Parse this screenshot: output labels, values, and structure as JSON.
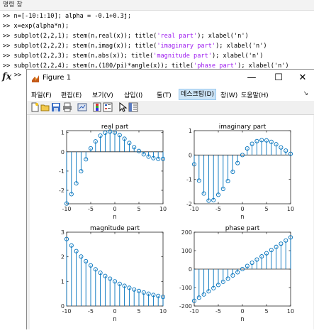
{
  "command_window": {
    "title": "명령 창",
    "lines": [
      {
        "prompt": ">>",
        "pre": "n=[-10:1:10]; alpha = -0.1+0.3j;",
        "str": "",
        "post": ""
      },
      {
        "prompt": ">>",
        "pre": "x=exp(alpha*n);",
        "str": "",
        "post": ""
      },
      {
        "prompt": ">>",
        "pre": "subplot(2,2,1); stem(n,real(x)); title(",
        "str": "'real part'",
        "post": "); xlabel('n')"
      },
      {
        "prompt": ">>",
        "pre": "subplot(2,2,2); stem(n,imag(x)); title(",
        "str": "'imaginary part'",
        "post": "); xlabel('n')"
      },
      {
        "prompt": ">>",
        "pre": "subplot(2,2,3); stem(n,abs(x)); title(",
        "str": "'magnitude part'",
        "post": "); xlabel('n')"
      },
      {
        "prompt": ">>",
        "pre": "subplot(2,2,4); stem(n,(180/pi)*angle(x)); title(",
        "str": "'phase part'",
        "post": "); xlabel('n')"
      }
    ],
    "fx_symbol": "fx",
    "current_prompt": ">>"
  },
  "figure": {
    "title": "Figure 1",
    "window_buttons": {
      "minimize": "—",
      "maximize": "☐",
      "close": "✕"
    },
    "menu": [
      "파일(F)",
      "편집(E)",
      "보기(V)",
      "삽입(I)",
      "툴(T)",
      "데스크탑(D)",
      "창(W)",
      "도움말(H)"
    ],
    "active_menu": "데스크탑(D)",
    "menu_arrow": "↘",
    "toolbar_icons": [
      "new-figure-icon",
      "open-file-icon",
      "save-icon",
      "print-icon",
      "link-plot-icon",
      "insert-colorbar-icon",
      "insert-legend-icon",
      "pointer-icon",
      "property-inspector-icon"
    ]
  },
  "chart_data": [
    {
      "type": "scatter",
      "style": "stem",
      "title": "real part",
      "xlabel": "n",
      "xlim": [
        -10,
        10
      ],
      "ylim": [
        -2.7,
        1.1
      ],
      "xticks": [
        "-10",
        "-5",
        "0",
        "5",
        "10"
      ],
      "yticks": [
        "-2",
        "-1",
        "0",
        "1"
      ],
      "ytick_values": [
        -2,
        -1,
        0,
        1
      ],
      "x": [
        -10,
        -9,
        -8,
        -7,
        -6,
        -5,
        -4,
        -3,
        -2,
        -1,
        0,
        1,
        2,
        3,
        4,
        5,
        6,
        7,
        8,
        9,
        10
      ],
      "y": [
        -2.69,
        -2.2,
        -1.64,
        -1.01,
        -0.39,
        0.18,
        0.54,
        0.84,
        0.99,
        1.05,
        1.0,
        0.87,
        0.68,
        0.46,
        0.24,
        0.04,
        -0.13,
        -0.25,
        -0.33,
        -0.37,
        -0.37
      ],
      "color": "#0072bd"
    },
    {
      "type": "scatter",
      "style": "stem",
      "title": "imaginary part",
      "xlabel": "n",
      "xlim": [
        -10,
        10
      ],
      "ylim": [
        -2,
        1
      ],
      "xticks": [
        "-10",
        "-5",
        "0",
        "5",
        "10"
      ],
      "yticks": [
        "-2",
        "-1",
        "0",
        "1"
      ],
      "ytick_values": [
        -2,
        -1,
        0,
        1
      ],
      "x": [
        -10,
        -9,
        -8,
        -7,
        -6,
        -5,
        -4,
        -3,
        -2,
        -1,
        0,
        1,
        2,
        3,
        4,
        5,
        6,
        7,
        8,
        9,
        10
      ],
      "y": [
        -0.38,
        -1.05,
        -1.58,
        -1.87,
        -1.85,
        -1.63,
        -1.39,
        -1.07,
        -0.69,
        -0.33,
        0.0,
        0.27,
        0.46,
        0.57,
        0.61,
        0.6,
        0.54,
        0.44,
        0.31,
        0.18,
        0.05
      ],
      "color": "#0072bd"
    },
    {
      "type": "scatter",
      "style": "stem",
      "title": "magnitude part",
      "xlabel": "n",
      "xlim": [
        -10,
        10
      ],
      "ylim": [
        0,
        3
      ],
      "xticks": [
        "-10",
        "-5",
        "0",
        "5",
        "10"
      ],
      "yticks": [
        "0",
        "1",
        "2",
        "3"
      ],
      "ytick_values": [
        0,
        1,
        2,
        3
      ],
      "x": [
        -10,
        -9,
        -8,
        -7,
        -6,
        -5,
        -4,
        -3,
        -2,
        -1,
        0,
        1,
        2,
        3,
        4,
        5,
        6,
        7,
        8,
        9,
        10
      ],
      "y": [
        2.72,
        2.46,
        2.23,
        2.01,
        1.82,
        1.65,
        1.49,
        1.35,
        1.22,
        1.11,
        1.0,
        0.9,
        0.82,
        0.74,
        0.67,
        0.61,
        0.55,
        0.5,
        0.45,
        0.41,
        0.37
      ],
      "color": "#0072bd"
    },
    {
      "type": "scatter",
      "style": "stem",
      "title": "phase part",
      "xlabel": "n",
      "xlim": [
        -10,
        10
      ],
      "ylim": [
        -200,
        200
      ],
      "xticks": [
        "-10",
        "-5",
        "0",
        "5",
        "10"
      ],
      "yticks": [
        "-200",
        "-100",
        "0",
        "100",
        "200"
      ],
      "ytick_values": [
        -200,
        -100,
        0,
        100,
        200
      ],
      "x": [
        -10,
        -9,
        -8,
        -7,
        -6,
        -5,
        -4,
        -3,
        -2,
        -1,
        0,
        1,
        2,
        3,
        4,
        5,
        6,
        7,
        8,
        9,
        10
      ],
      "y": [
        -171.9,
        -154.7,
        -137.5,
        -120.3,
        -103.1,
        -85.9,
        -68.8,
        -51.6,
        -34.4,
        -17.2,
        0,
        17.2,
        34.4,
        51.6,
        68.8,
        85.9,
        103.1,
        120.3,
        137.5,
        154.7,
        171.9
      ],
      "color": "#0072bd"
    }
  ]
}
